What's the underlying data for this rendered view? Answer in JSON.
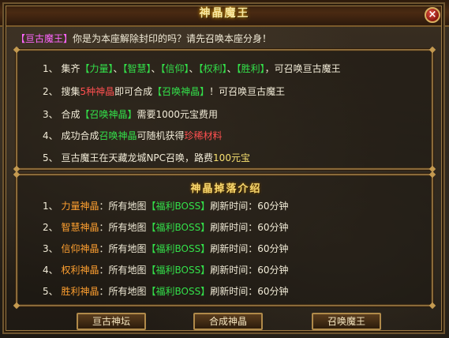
{
  "window": {
    "title": "神晶魔王",
    "close_label": "×"
  },
  "intro": {
    "tag": "【亘古魔王】",
    "text": "你是为本座解除封印的吗？请先召唤本座分身！"
  },
  "rules": [
    {
      "num": "1、",
      "parts": [
        {
          "t": "集齐",
          "c": "t"
        },
        {
          "t": "【力量】",
          "c": "g"
        },
        {
          "t": "、",
          "c": "t"
        },
        {
          "t": "【智慧】",
          "c": "g"
        },
        {
          "t": "、",
          "c": "t"
        },
        {
          "t": "【信仰】",
          "c": "g"
        },
        {
          "t": "、",
          "c": "t"
        },
        {
          "t": "【权利】",
          "c": "g"
        },
        {
          "t": "、",
          "c": "t"
        },
        {
          "t": "【胜利】",
          "c": "g"
        },
        {
          "t": "，可召唤亘古魔王",
          "c": "t"
        }
      ]
    },
    {
      "num": "2、",
      "parts": [
        {
          "t": "搜集",
          "c": "t"
        },
        {
          "t": "5种神晶",
          "c": "r"
        },
        {
          "t": "即可合成",
          "c": "t"
        },
        {
          "t": "【召唤神晶】",
          "c": "g"
        },
        {
          "t": "！可召唤亘古魔王",
          "c": "t"
        }
      ]
    },
    {
      "num": "3、",
      "parts": [
        {
          "t": "合成",
          "c": "t"
        },
        {
          "t": "【召唤神晶】",
          "c": "g"
        },
        {
          "t": "需要1000元宝费用",
          "c": "t"
        }
      ]
    },
    {
      "num": "4、",
      "parts": [
        {
          "t": "成功合成",
          "c": "t"
        },
        {
          "t": "召唤神晶",
          "c": "g"
        },
        {
          "t": "可随机获得",
          "c": "t"
        },
        {
          "t": "珍稀材料",
          "c": "r"
        }
      ]
    },
    {
      "num": "5、",
      "parts": [
        {
          "t": "亘古魔王在天藏龙城NPC召唤，路费",
          "c": "t"
        },
        {
          "t": "100元宝",
          "c": "y"
        }
      ]
    }
  ],
  "drops": {
    "title": "神晶掉落介绍",
    "items": [
      {
        "num": "1、",
        "name": "力量神晶",
        "text": "：所有地图",
        "tag": "【福利BOSS】",
        "refresh": "刷新时间：60分钟"
      },
      {
        "num": "2、",
        "name": "智慧神晶",
        "text": "：所有地图",
        "tag": "【福利BOSS】",
        "refresh": "刷新时间：60分钟"
      },
      {
        "num": "3、",
        "name": "信仰神晶",
        "text": "：所有地图",
        "tag": "【福利BOSS】",
        "refresh": "刷新时间：60分钟"
      },
      {
        "num": "4、",
        "name": "权利神晶",
        "text": "：所有地图",
        "tag": "【福利BOSS】",
        "refresh": "刷新时间：60分钟"
      },
      {
        "num": "5、",
        "name": "胜利神晶",
        "text": "：所有地图",
        "tag": "【福利BOSS】",
        "refresh": "刷新时间：60分钟"
      }
    ]
  },
  "buttons": {
    "altar": "亘古神坛",
    "craft": "合成神晶",
    "summon": "召唤魔王"
  },
  "colors": {
    "green": "#33e04a",
    "orange": "#ffa030",
    "red": "#ff5050",
    "gold": "#f7e070",
    "pink": "#ff66ff"
  }
}
